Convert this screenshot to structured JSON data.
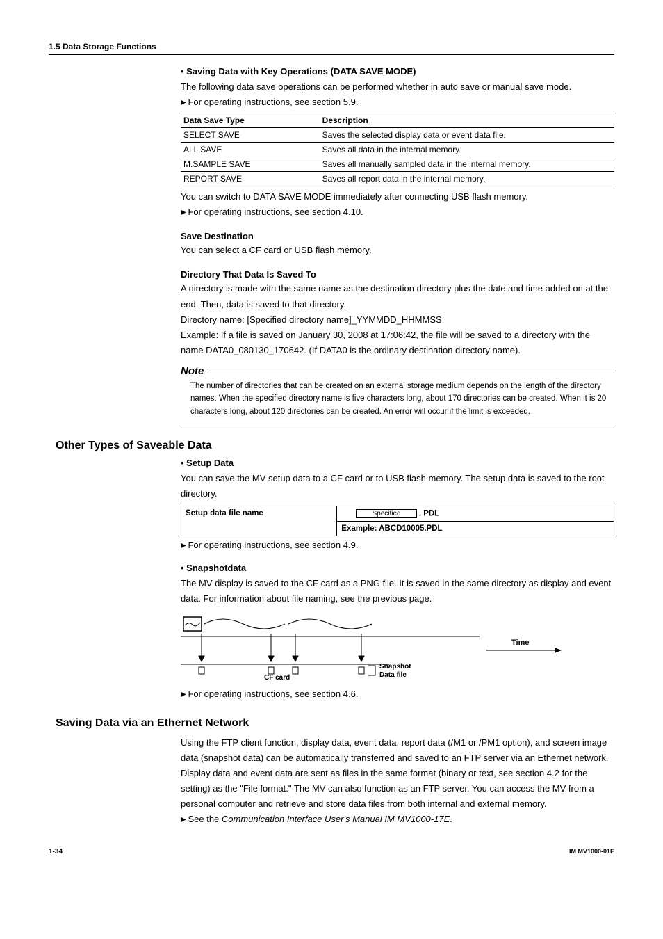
{
  "header": {
    "section": "1.5  Data Storage Functions"
  },
  "saveMode": {
    "title": "Saving Data with Key Operations (DATA SAVE MODE)",
    "intro": "The following data save operations can be performed whether in auto save or manual save mode.",
    "ref1": "For operating instructions, see section 5.9.",
    "tableHeaders": {
      "col1": "Data Save Type",
      "col2": "Description"
    },
    "rows": [
      {
        "type": "SELECT SAVE",
        "desc": "Saves the selected display data or event data file."
      },
      {
        "type": "ALL SAVE",
        "desc": "Saves all data in the internal memory."
      },
      {
        "type": "M.SAMPLE SAVE",
        "desc": "Saves all manually sampled data in the internal memory."
      },
      {
        "type": "REPORT SAVE",
        "desc": "Saves all report data in the internal memory."
      }
    ],
    "usbNote": "You can switch to DATA SAVE MODE immediately after connecting USB flash memory.",
    "ref2": "For operating instructions, see section 4.10."
  },
  "saveDest": {
    "title": "Save Destination",
    "body": "You can select a CF card or USB flash memory."
  },
  "directory": {
    "title": "Directory That Data Is Saved To",
    "p1": "A directory is made with the same name as the destination directory plus the date and time added on at the end. Then, data is saved to that directory.",
    "p2": "Directory name: [Specified directory name]_YYMMDD_HHMMSS",
    "p3": "Example: If a file is saved on January 30, 2008 at 17:06:42, the file will be saved to a directory with the name DATA0_080130_170642. (If DATA0 is the ordinary destination directory name)."
  },
  "note": {
    "label": "Note",
    "body": "The number of directories that can be created on an external storage medium depends on the length of the directory names. When the specified directory name is five characters long, about 170 directories can be created. When it is 20 characters long, about 120 directories can be created. An error will occur if the limit is exceeded."
  },
  "otherTypes": {
    "heading": "Other Types of Saveable Data",
    "setup": {
      "title": "Setup Data",
      "body": "You can save the MV setup data to a CF card or to USB flash memory. The setup data is saved to the root directory.",
      "tableLabel": "Setup data file name",
      "specLabel": "Specified",
      "ext": ". PDL",
      "example": "Example: ABCD10005.PDL",
      "ref": "For operating instructions, see section 4.9."
    },
    "snapshot": {
      "title": "Snapshotdata",
      "body": "The MV display is saved to the CF card as a PNG file. It is saved in the same directory as display and event data. For information about file naming, see the previous page.",
      "labels": {
        "time": "Time",
        "cfcard": "CF card",
        "snapshot": "Snapshot",
        "datafile": "Data file"
      },
      "ref": "For operating instructions, see section 4.6."
    }
  },
  "ethernet": {
    "heading": "Saving Data via an Ethernet Network",
    "body": "Using the FTP client function, display data, event data, report data (/M1 or /PM1 option), and screen image data (snapshot data) can be automatically transferred and saved to an FTP server via an Ethernet network. Display data and event data are sent as files in the same format (binary or text, see section 4.2 for the setting) as the \"File format.\" The MV can also function as an FTP server. You can access the MV from a personal computer and retrieve and store data files from both internal and external memory.",
    "refPrefix": "See the ",
    "refItalic": "Communication Interface User's Manual IM MV1000-17E",
    "refSuffix": "."
  },
  "footer": {
    "left": "1-34",
    "right": "IM MV1000-01E"
  }
}
